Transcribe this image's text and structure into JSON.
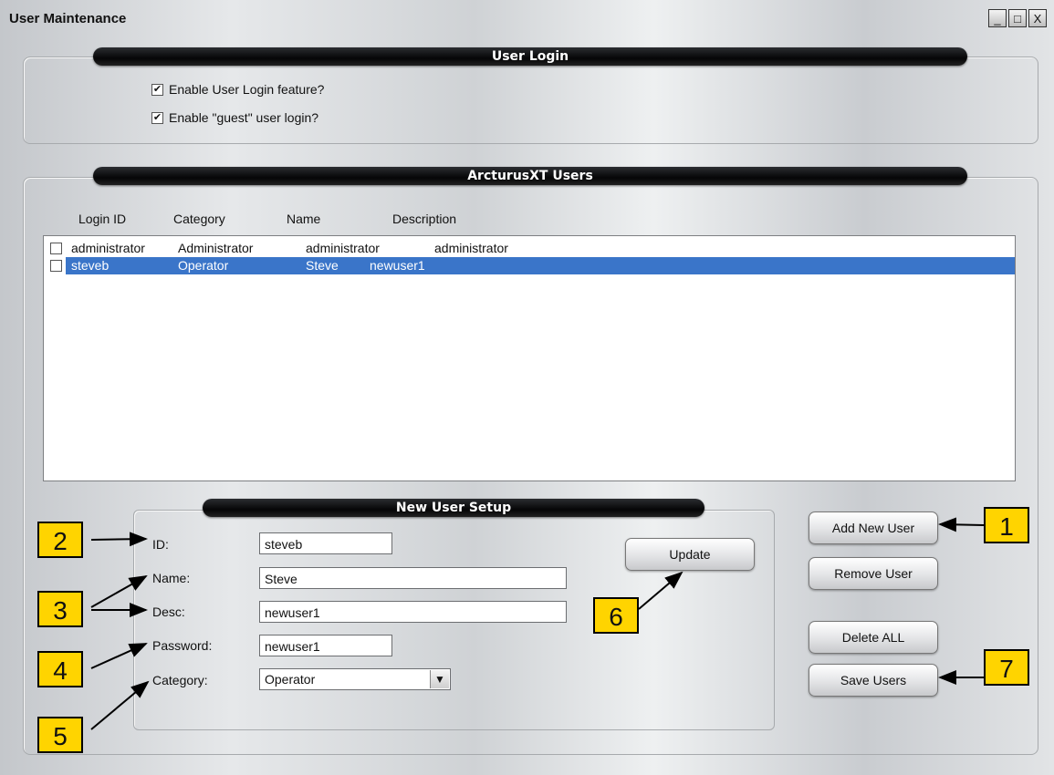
{
  "window": {
    "title": "User Maintenance",
    "controls": [
      "_",
      "□",
      "X"
    ]
  },
  "user_login": {
    "header": "User Login",
    "enable_login_label": "Enable User Login feature?",
    "enable_login_checked": true,
    "enable_guest_label": "Enable \"guest\" user login?",
    "enable_guest_checked": true
  },
  "users": {
    "header": "ArcturusXT Users",
    "columns": [
      "Login ID",
      "Category",
      "Name",
      "Description"
    ],
    "rows": [
      {
        "login_id": "administrator",
        "category": "Administrator",
        "name": "administrator",
        "description": "administrator",
        "selected": false
      },
      {
        "login_id": "steveb",
        "category": "Operator",
        "name": "Steve",
        "description": "newuser1",
        "selected": true
      }
    ]
  },
  "new_user": {
    "header": "New User Setup",
    "id_label": "ID:",
    "id_value": "steveb",
    "name_label": "Name:",
    "name_value": "Steve",
    "desc_label": "Desc:",
    "desc_value": "newuser1",
    "password_label": "Password:",
    "password_value": "newuser1",
    "category_label": "Category:",
    "category_value": "Operator",
    "update_label": "Update"
  },
  "actions": {
    "add_label": "Add New User",
    "remove_label": "Remove User",
    "delete_all_label": "Delete ALL",
    "save_label": "Save Users"
  },
  "callouts": [
    "1",
    "2",
    "3",
    "4",
    "5",
    "6",
    "7"
  ],
  "colors": {
    "selection": "#3a75c9",
    "callout": "#ffd400",
    "pill": "#050506"
  }
}
